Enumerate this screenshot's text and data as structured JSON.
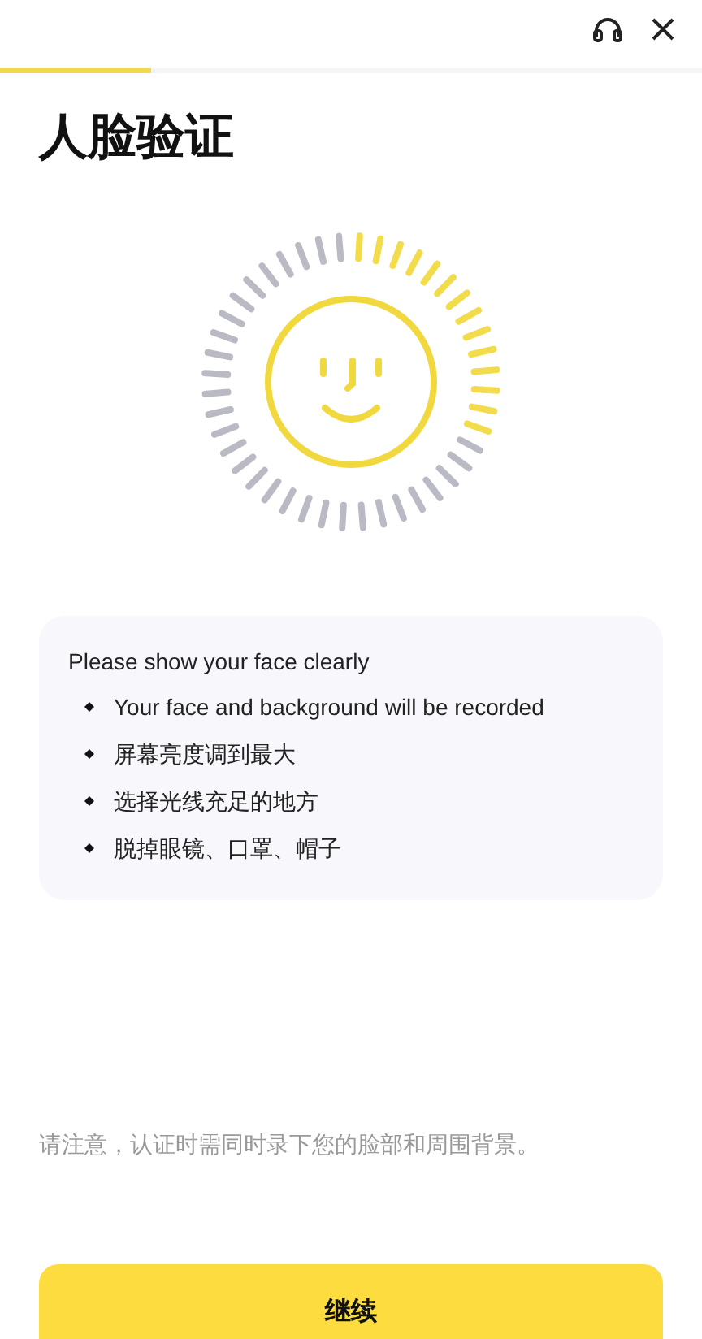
{
  "header": {
    "progress": {
      "level": 0.215
    }
  },
  "title": "人脸验证",
  "tips": {
    "heading": "Please show your face clearly",
    "items": [
      "Your face and background will be recorded",
      "屏幕亮度调到最大",
      "选择光线充足的地方",
      "脱掉眼镜、口罩、帽子"
    ]
  },
  "notice": "请注意，认证时需同时录下您的脸部和周围背景。",
  "continue_button": "继续"
}
